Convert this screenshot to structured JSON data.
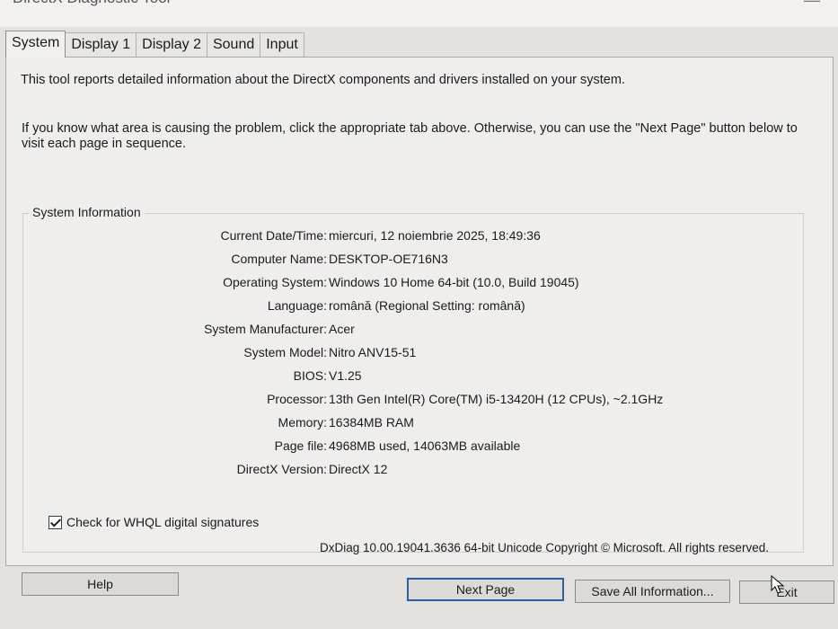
{
  "window": {
    "title": "DirectX Diagnostic Tool"
  },
  "tabs": [
    {
      "label": "System",
      "active": true
    },
    {
      "label": "Display 1",
      "active": false
    },
    {
      "label": "Display 2",
      "active": false
    },
    {
      "label": "Sound",
      "active": false
    },
    {
      "label": "Input",
      "active": false
    }
  ],
  "intro": {
    "line1": "This tool reports detailed information about the DirectX components and drivers installed on your system.",
    "line2": "If you know what area is causing the problem, click the appropriate tab above.  Otherwise, you can use the \"Next Page\" button below to visit each page in sequence."
  },
  "system_info": {
    "legend": "System Information",
    "rows": [
      {
        "label": "Current Date/Time:",
        "value": "miercuri, 12 noiembrie 2025, 18:49:36"
      },
      {
        "label": "Computer Name:",
        "value": "DESKTOP-OE716N3"
      },
      {
        "label": "Operating System:",
        "value": "Windows 10 Home 64-bit (10.0, Build 19045)"
      },
      {
        "label": "Language:",
        "value": "română (Regional Setting: română)"
      },
      {
        "label": "System Manufacturer:",
        "value": "Acer"
      },
      {
        "label": "System Model:",
        "value": "Nitro ANV15-51"
      },
      {
        "label": "BIOS:",
        "value": "V1.25"
      },
      {
        "label": "Processor:",
        "value": "13th Gen Intel(R) Core(TM) i5-13420H (12 CPUs), ~2.1GHz"
      },
      {
        "label": "Memory:",
        "value": "16384MB RAM"
      },
      {
        "label": "Page file:",
        "value": "4968MB used, 14063MB available"
      },
      {
        "label": "DirectX Version:",
        "value": "DirectX 12"
      }
    ]
  },
  "whql": {
    "label": "Check for WHQL digital signatures",
    "checked": true
  },
  "footer": "DxDiag 10.00.19041.3636 64-bit Unicode  Copyright © Microsoft. All rights reserved.",
  "buttons": {
    "help": "Help",
    "next_page": "Next Page",
    "save_all": "Save All Information...",
    "exit": "Exit"
  }
}
